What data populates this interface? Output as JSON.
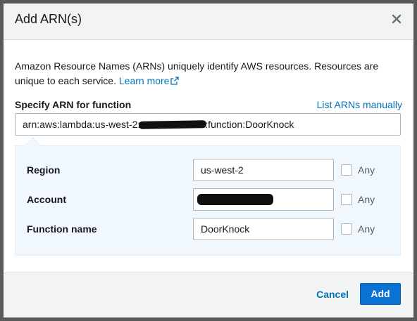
{
  "dialog": {
    "title": "Add ARN(s)"
  },
  "description": {
    "text": "Amazon Resource Names (ARNs) uniquely identify AWS resources. Resources are unique to each service. ",
    "learn_more": "Learn more"
  },
  "arn": {
    "label": "Specify ARN for function",
    "list_manually": "List ARNs manually",
    "value_prefix": "arn:aws:lambda:us-west-2:",
    "value_suffix": ":function:DoorKnock"
  },
  "fields": {
    "region": {
      "label": "Region",
      "value": "us-west-2",
      "any": "Any"
    },
    "account": {
      "label": "Account",
      "value": "",
      "any": "Any"
    },
    "function_name": {
      "label": "Function name",
      "value": "DoorKnock",
      "any": "Any"
    }
  },
  "footer": {
    "cancel": "Cancel",
    "add": "Add"
  },
  "colors": {
    "link": "#0073bb",
    "primary_button": "#0972d3",
    "panel_bg": "#f0f8fd"
  },
  "icons": {
    "close": "close-icon",
    "external_link": "external-link-icon"
  }
}
